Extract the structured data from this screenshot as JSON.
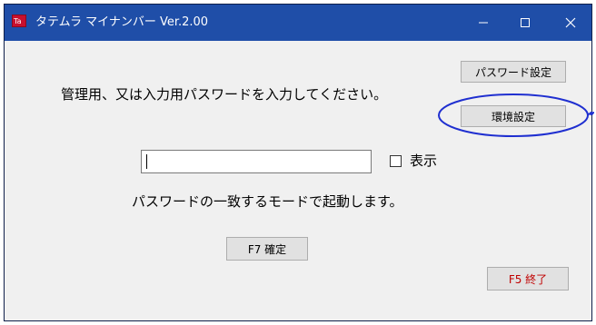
{
  "window": {
    "title": "タテムラ マイナンバー Ver.2.00",
    "title_bar_color": "#1f4ea8",
    "app_icon": "tatemura-logo-icon"
  },
  "title_controls": {
    "minimize_icon": "minimize-icon",
    "maximize_icon": "maximize-icon",
    "close_icon": "close-icon"
  },
  "main": {
    "prompt": "管理用、又は入力用パスワードを入力してください。",
    "password_value": "",
    "show_label": "表示",
    "show_checked": false,
    "mode_message": "パスワードの一致するモードで起動します。"
  },
  "buttons": {
    "password_settings": "パスワード設定",
    "environment_settings": "環境設定",
    "confirm": "F7 確定",
    "exit": "F5 終了"
  },
  "colors": {
    "exit_text": "#c00000",
    "annotation": "#1f2fd0"
  }
}
